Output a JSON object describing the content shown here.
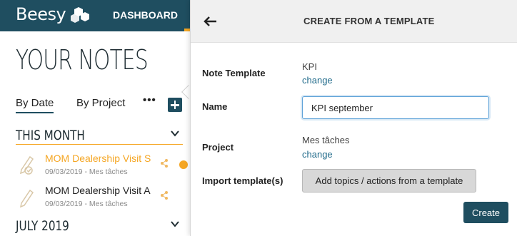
{
  "topbar": {
    "logo_text": "Beesy",
    "nav_dashboard": "DASHBOARD"
  },
  "notes_panel": {
    "title": "YOUR NOTES",
    "tabs": [
      "By Date",
      "By Project"
    ],
    "more": "•••",
    "sections": [
      {
        "title": "THIS MONTH",
        "notes": [
          {
            "title": "MOM Dealership Visit S",
            "date": "09/03/2019",
            "project": "Mes tâches",
            "highlighted": true
          },
          {
            "title": "MOM Dealership Visit A",
            "date": "09/03/2019",
            "project": "Mes tâches",
            "highlighted": false
          }
        ]
      },
      {
        "title": "JULY 2019",
        "notes": []
      }
    ]
  },
  "modal": {
    "title": "CREATE FROM A TEMPLATE",
    "note_template_label": "Note Template",
    "note_template_value": "KPI",
    "change_label": "change",
    "name_label": "Name",
    "name_value": "KPI september",
    "project_label": "Project",
    "project_value": "Mes tâches",
    "import_label": "Import template(s)",
    "import_button": "Add topics / actions from a template",
    "create_button": "Create"
  },
  "colors": {
    "brand": "#1f4e60",
    "accent": "#f5a623",
    "link": "#1f6a8a"
  }
}
